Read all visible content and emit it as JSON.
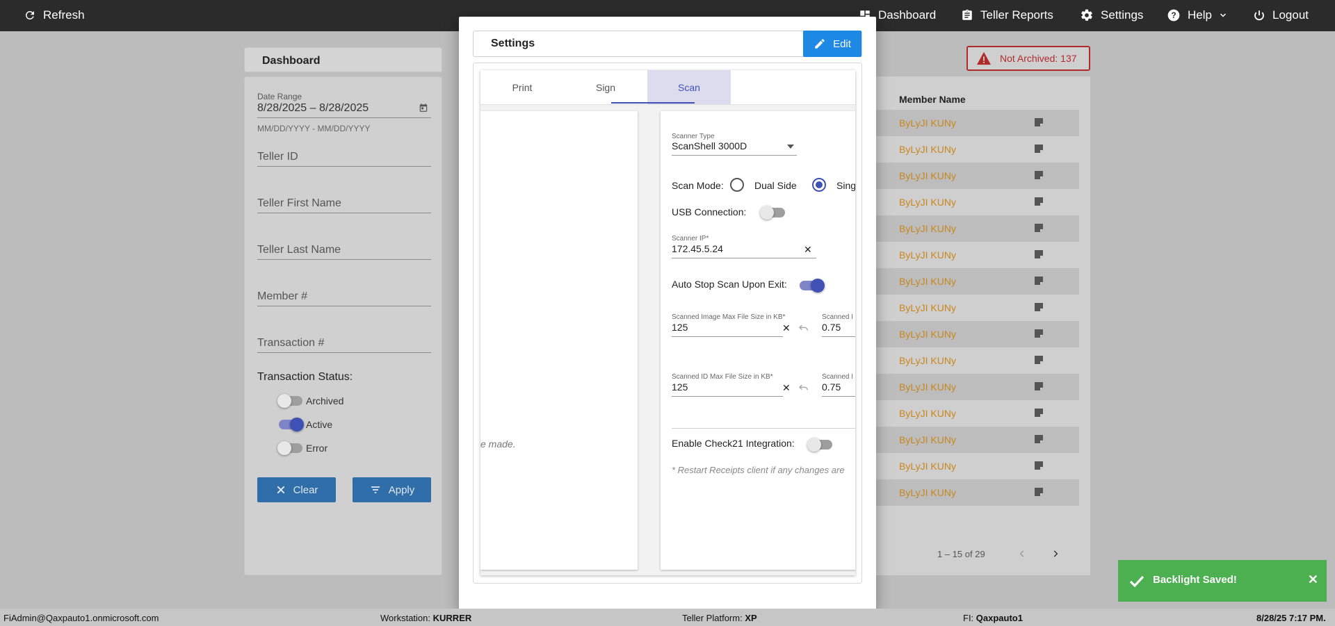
{
  "topbar": {
    "refresh_label": "Refresh",
    "nav": [
      {
        "label": "Dashboard",
        "icon": "dashboard-icon"
      },
      {
        "label": "Teller Reports",
        "icon": "clipboard-icon"
      },
      {
        "label": "Settings",
        "icon": "gear-icon"
      },
      {
        "label": "Help",
        "icon": "help-icon"
      },
      {
        "label": "Logout",
        "icon": "power-icon"
      }
    ]
  },
  "dashboard": {
    "title": "Dashboard",
    "not_archived": "Not Archived: 137",
    "filters": {
      "date_range_label": "Date Range",
      "date_range_value": "8/28/2025 – 8/28/2025",
      "date_hint": "MM/DD/YYYY - MM/DD/YYYY",
      "teller_id": "Teller ID",
      "teller_first_name": "Teller First Name",
      "teller_last_name": "Teller Last Name",
      "member_number": "Member #",
      "transaction_number": "Transaction #",
      "status_label": "Transaction Status:",
      "statuses": [
        {
          "label": "Archived",
          "on": false
        },
        {
          "label": "Active",
          "on": true
        },
        {
          "label": "Error",
          "on": false
        }
      ],
      "clear_label": "Clear",
      "apply_label": "Apply"
    },
    "table": {
      "member_name_header": "Member Name",
      "rows": [
        "ByLyJI KUNy",
        "ByLyJI KUNy",
        "ByLyJI KUNy",
        "ByLyJI KUNy",
        "ByLyJI KUNy",
        "ByLyJI KUNy",
        "ByLyJI KUNy",
        "ByLyJI KUNy",
        "ByLyJI KUNy",
        "ByLyJI KUNy",
        "ByLyJI KUNy",
        "ByLyJI KUNy",
        "ByLyJI KUNy",
        "ByLyJI KUNy",
        "ByLyJI KUNy"
      ],
      "pagination": "1 – 15 of 29"
    }
  },
  "modal": {
    "title": "Settings",
    "edit_label": "Edit",
    "tabs": [
      "Print",
      "Sign",
      "Scan"
    ],
    "active_tab": "Scan",
    "left_message": "e made.",
    "scan": {
      "scanner_type_label": "Scanner Type",
      "scanner_type_value": "ScanShell 3000D",
      "scan_mode_label": "Scan Mode:",
      "scan_mode_dual": "Dual Side",
      "scan_mode_single": "Sing",
      "usb_label": "USB Connection:",
      "scanner_ip_label": "Scanner IP*",
      "scanner_ip_value": "172.45.5.24",
      "auto_stop_label": "Auto Stop Scan Upon Exit:",
      "img_max_label": "Scanned Image Max File Size in KB*",
      "img_max_value": "125",
      "img_second_label": "Scanned I",
      "img_second_value": "0.75",
      "id_max_label": "Scanned ID Max File Size in KB*",
      "id_max_value": "125",
      "id_second_label": "Scanned I",
      "id_second_value": "0.75",
      "check21_label": "Enable Check21 Integration:",
      "restart_note": "* Restart Receipts client if any changes are"
    }
  },
  "toast": {
    "message": "Backlight Saved!"
  },
  "footer": {
    "user": "FiAdmin@Qaxpauto1.onmicrosoft.com",
    "workstation_label": "Workstation:",
    "workstation_value": "KURRER",
    "platform_label": "Teller Platform:",
    "platform_value": "XP",
    "fi_label": "FI:",
    "fi_value": "Qaxpauto1",
    "datetime": "8/28/25 7:17 PM."
  },
  "colors": {
    "accent": "#3f51b5",
    "edit": "#1e88e5",
    "toast": "#4caf50",
    "member_name": "#c8861c",
    "warning": "#b02a2a"
  }
}
